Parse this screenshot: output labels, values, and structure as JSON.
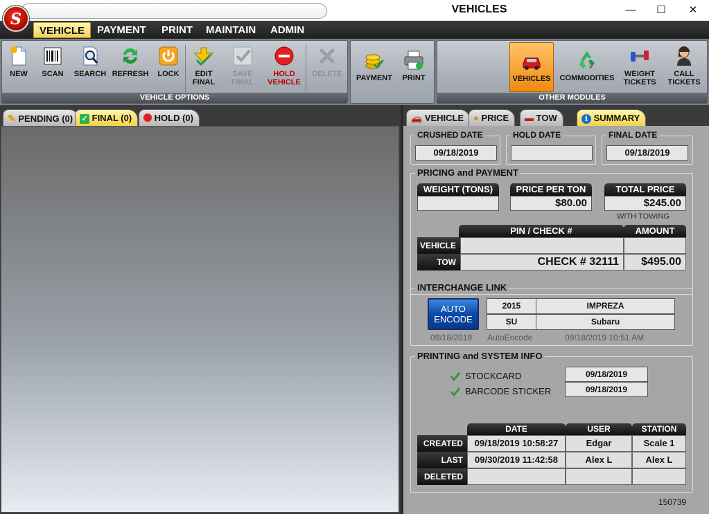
{
  "window": {
    "title": "VEHICLES",
    "logo_letter": "S",
    "minimize": "—",
    "maximize": "☐",
    "close": "✕"
  },
  "menu": {
    "items": [
      "VEHICLE",
      "PAYMENT",
      "PRINT",
      "MAINTAIN",
      "ADMIN"
    ]
  },
  "ribbon": {
    "vehicle_options": {
      "label": "VEHICLE OPTIONS",
      "buttons": {
        "new": "NEW",
        "scan": "SCAN",
        "search": "SEARCH",
        "refresh": "REFRESH",
        "lock": "LOCK",
        "edit_final_1": "EDIT",
        "edit_final_2": "FINAL",
        "save_final_1": "SAVE",
        "save_final_2": "FINAL",
        "hold_1": "HOLD",
        "hold_2": "VEHICLE",
        "delete": "DELETE"
      }
    },
    "payment_group": {
      "payment": "PAYMENT",
      "print": "PRINT"
    },
    "other_modules": {
      "label": "OTHER MODULES",
      "buttons": {
        "vehicles": "VEHICLES",
        "commodities": "COMMODITIES",
        "weight_1": "WEIGHT",
        "weight_2": "TICKETS",
        "call_1": "CALL",
        "call_2": "TICKETS"
      }
    }
  },
  "left_tabs": {
    "pending": "PENDING (0)",
    "final": "FINAL (0)",
    "hold": "HOLD (0)"
  },
  "right_tabs": {
    "vehicle": "VEHICLE",
    "price": "PRICE",
    "tow": "TOW",
    "summary": "SUMMARY"
  },
  "summary": {
    "dates": {
      "crushed_label": "CRUSHED DATE",
      "crushed": "09/18/2019",
      "hold_label": "HOLD DATE",
      "hold": "",
      "final_label": "FINAL DATE",
      "final": "09/18/2019"
    },
    "pricing": {
      "label": "PRICING and PAYMENT",
      "weight_label": "WEIGHT (TONS)",
      "weight": "",
      "ppt_label": "PRICE PER TON",
      "ppt": "$80.00",
      "total_label": "TOTAL PRICE",
      "total": "$245.00",
      "with_towing": "WITH TOWING",
      "pin_header": "PIN / CHECK #",
      "amount_header": "AMOUNT",
      "vehicle_row": "VEHICLE",
      "vehicle_pin": "",
      "vehicle_amount": "",
      "tow_row": "TOW",
      "tow_pin": "CHECK # 32111",
      "tow_amount": "$495.00"
    },
    "interchange": {
      "label": "INTERCHANGE LINK",
      "button_1": "AUTO",
      "button_2": "ENCODE",
      "year": "2015",
      "model": "IMPREZA",
      "make_code": "SU",
      "make": "Subaru",
      "date": "09/18/2019",
      "source": "AutoEncode",
      "timestamp": "09/18/2019 10:51 AM"
    },
    "printing": {
      "label": "PRINTING and SYSTEM INFO",
      "stockcard_label": "STOCKCARD",
      "stockcard_date": "09/18/2019",
      "barcode_label": "BARCODE STICKER",
      "barcode_date": "09/18/2019",
      "headers": {
        "date": "DATE",
        "user": "USER",
        "station": "STATION"
      },
      "created": {
        "label": "CREATED",
        "date": "09/18/2019 10:58:27",
        "user": "Edgar",
        "station": "Scale 1"
      },
      "last": {
        "label": "LAST",
        "date": "09/30/2019 11:42:58",
        "user": "Alex L",
        "station": "Alex L"
      },
      "deleted": {
        "label": "DELETED",
        "date": "",
        "user": "",
        "station": ""
      }
    },
    "record_id": "150739"
  }
}
